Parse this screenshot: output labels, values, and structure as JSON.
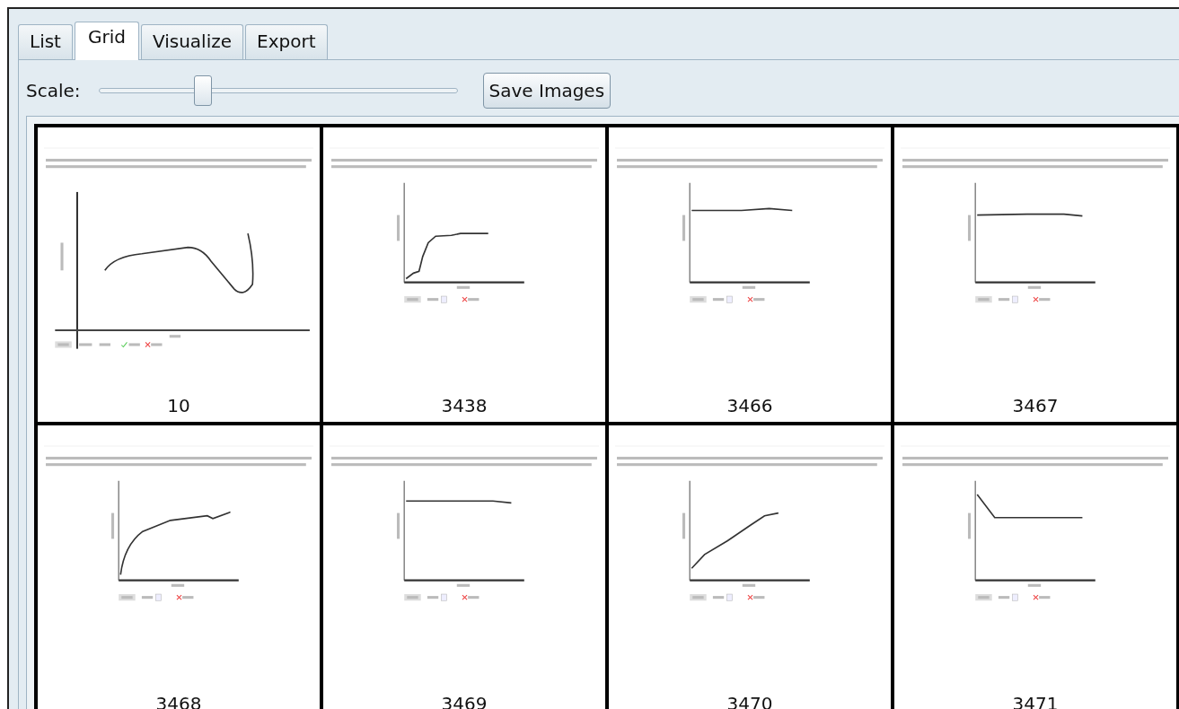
{
  "tabs": [
    {
      "label": "List",
      "selected": false
    },
    {
      "label": "Grid",
      "selected": true
    },
    {
      "label": "Visualize",
      "selected": false
    },
    {
      "label": "Export",
      "selected": false
    }
  ],
  "scale": {
    "label": "Scale:",
    "level": 0.29
  },
  "save_button": "Save Images",
  "cells": [
    {
      "label": "10",
      "thumbnail": {
        "kind": "wide"
      }
    },
    {
      "label": "3438",
      "thumbnail": {
        "kind": "compact"
      }
    },
    {
      "label": "3466",
      "thumbnail": {
        "kind": "compact"
      }
    },
    {
      "label": "3467",
      "thumbnail": {
        "kind": "compact"
      }
    },
    {
      "label": "3468",
      "thumbnail": {
        "kind": "compact"
      }
    },
    {
      "label": "3469",
      "thumbnail": {
        "kind": "compact"
      }
    },
    {
      "label": "3470",
      "thumbnail": {
        "kind": "compact"
      }
    },
    {
      "label": "3471",
      "thumbnail": {
        "kind": "compact"
      }
    }
  ]
}
